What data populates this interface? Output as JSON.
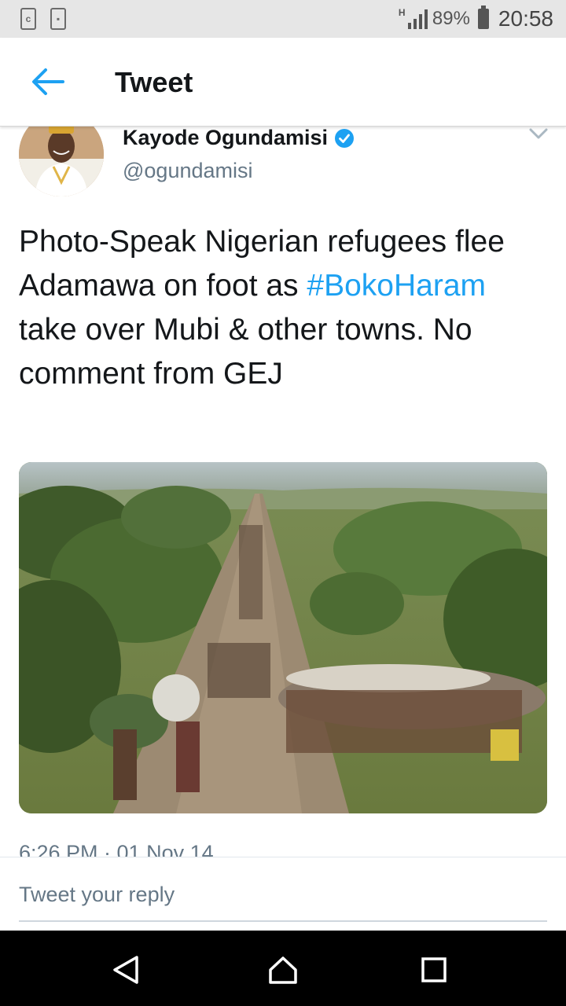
{
  "status_bar": {
    "network": "H",
    "battery_percent": "89%",
    "time": "20:58",
    "left_icons": [
      "sync-icon",
      "clipboard-icon"
    ]
  },
  "header": {
    "title": "Tweet",
    "back_icon": "arrow-left-icon"
  },
  "tweet": {
    "author_name": "Kayode Ogundamisi",
    "handle": "@ogundamisi",
    "verified": true,
    "text_before": "Photo-Speak Nigerian refugees flee Adamawa on foot as ",
    "hashtag": "#BokoHaram",
    "text_after": " take over Mubi & other towns. No comment from GEJ",
    "timestamp": "6:26 PM · 01 Nov 14"
  },
  "reply": {
    "placeholder": "Tweet your reply"
  },
  "colors": {
    "accent": "#1da1f2",
    "secondary_text": "#657786"
  }
}
